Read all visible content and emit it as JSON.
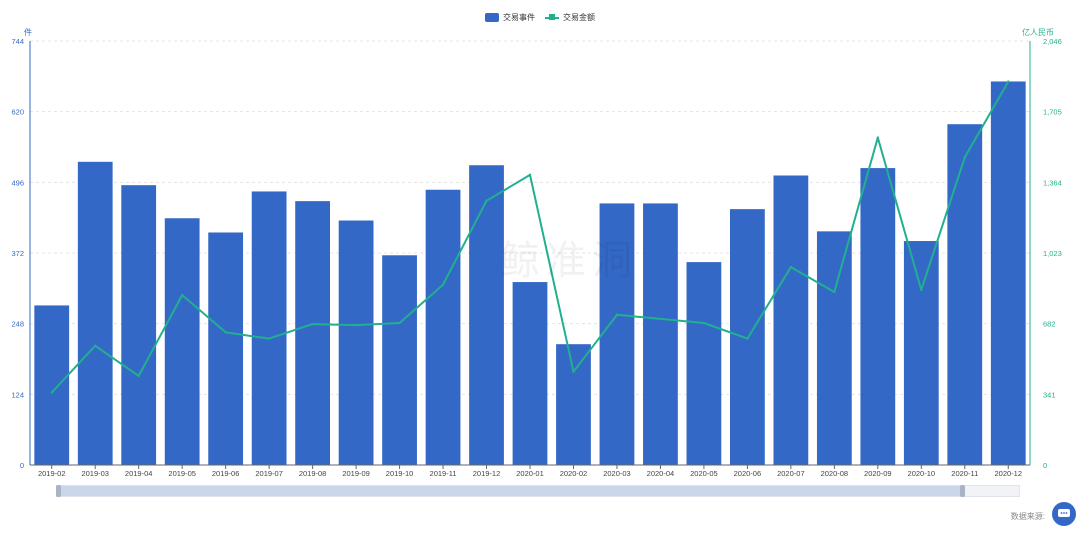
{
  "legend": {
    "bar_label": "交易事件",
    "line_label": "交易金额"
  },
  "watermark": "鲸准洞",
  "footer": {
    "source_label": "数据来源:"
  },
  "colors": {
    "bar": "#3468c6",
    "line": "#21b08f",
    "left_axis": "#3468c6",
    "right_axis": "#21b08f"
  },
  "chart_data": {
    "type": "bar",
    "title": "",
    "categories": [
      "2019-02",
      "2019-03",
      "2019-04",
      "2019-05",
      "2019-06",
      "2019-07",
      "2019-08",
      "2019-09",
      "2019-10",
      "2019-11",
      "2019-12",
      "2020-01",
      "2020-02",
      "2020-03",
      "2020-04",
      "2020-05",
      "2020-06",
      "2020-07",
      "2020-08",
      "2020-09",
      "2020-10",
      "2020-11",
      "2020-12"
    ],
    "series": [
      {
        "name": "交易事件",
        "type": "bar",
        "axis": "left",
        "values": [
          280,
          532,
          491,
          433,
          408,
          480,
          463,
          429,
          368,
          483,
          526,
          321,
          212,
          459,
          459,
          356,
          449,
          508,
          410,
          521,
          393,
          598,
          673
        ]
      },
      {
        "name": "交易金额",
        "type": "line",
        "axis": "right",
        "values": [
          350,
          575,
          430,
          820,
          640,
          610,
          680,
          675,
          685,
          870,
          1275,
          1400,
          450,
          725,
          705,
          685,
          610,
          955,
          835,
          1580,
          845,
          1485,
          1850
        ]
      }
    ],
    "left_axis": {
      "unit": "件",
      "ticks": [
        0,
        124,
        248,
        372,
        496,
        620,
        744
      ],
      "ylim": [
        0,
        744
      ]
    },
    "right_axis": {
      "unit": "亿人民币",
      "ticks": [
        "0",
        "341",
        "682",
        "1,023",
        "1,364",
        "1,705",
        "2,046"
      ],
      "ylim": [
        0,
        2046
      ]
    },
    "grid": true,
    "legend_position": "top-center"
  }
}
